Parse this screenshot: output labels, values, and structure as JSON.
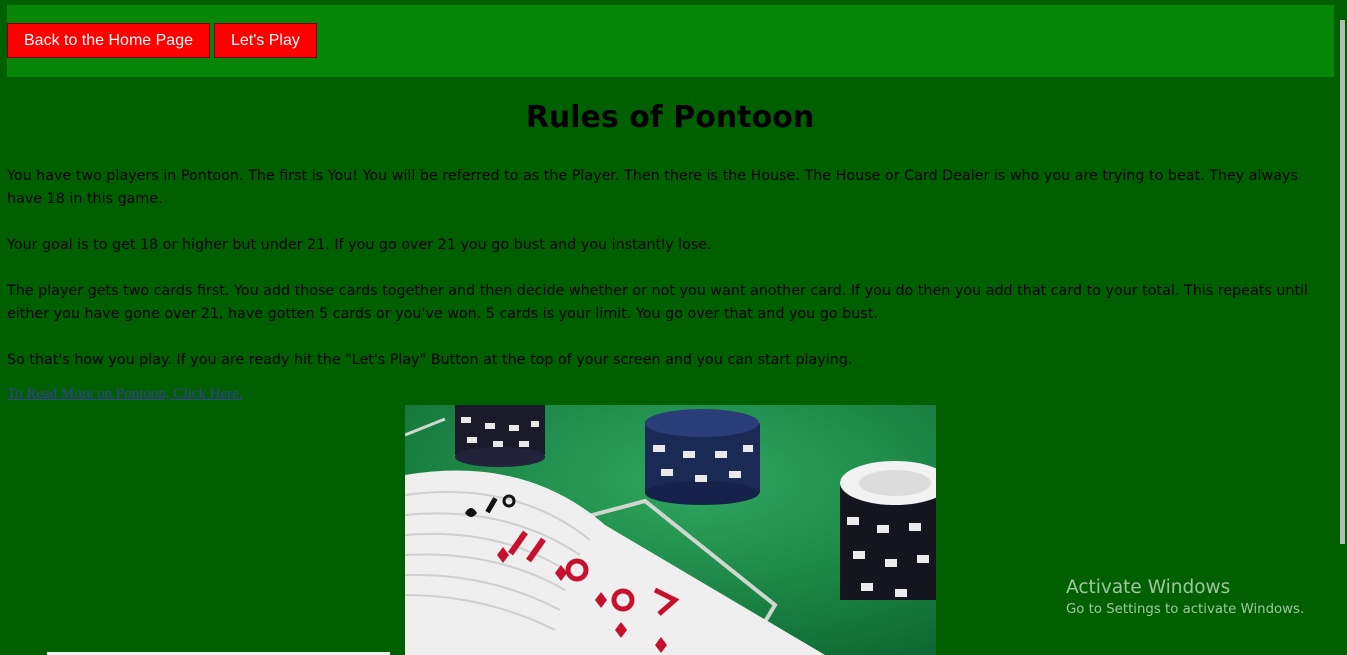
{
  "nav": {
    "home_label": "Back to the Home Page",
    "play_label": "Let's Play"
  },
  "main": {
    "title": "Rules of Pontoon",
    "paragraphs": [
      "You have two players in Pontoon. The first is You! You will be referred to as the Player. Then there is the House. The House or Card Dealer is who you are trying to beat. They always have 18 in this game.",
      "Your goal is to get 18 or higher but under 21. If you go over 21 you go bust and you instantly lose.",
      "The player gets two cards first. You add those cards together and then decide whether or not you want another card. If you do then you add that card to your total. This repeats until either you have gone over 21, have gotten 5 cards or you've won. 5 cards is your limit. You go over that and you go bust.",
      "So that's how you play. If you are ready hit the \"Let's Play\" Button at the top of your screen and you can start playing."
    ],
    "more_link": "To Read More on Pontoon, Click Here."
  },
  "watermark": {
    "title": "Activate Windows",
    "subtitle": "Go to Settings to activate Windows."
  },
  "colors": {
    "page_bg": "#006000",
    "navbar_bg": "#078607",
    "button_bg": "#ff0000",
    "button_text": "#ffffff"
  }
}
